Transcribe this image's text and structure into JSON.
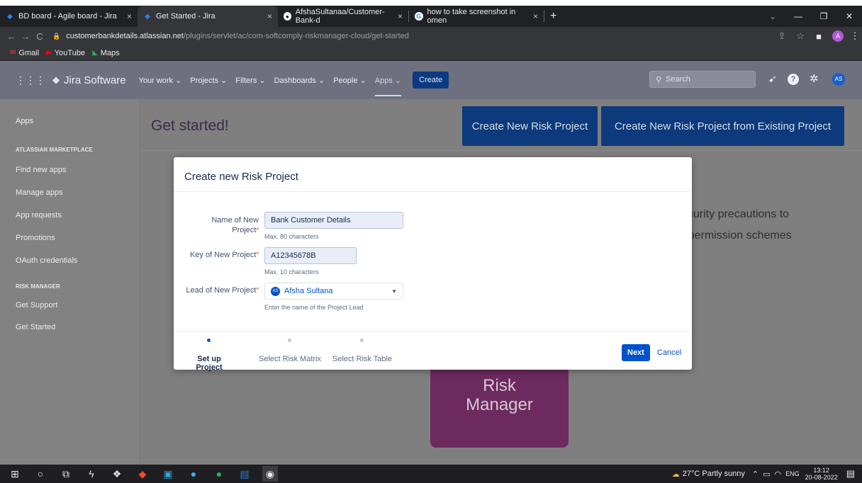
{
  "browser": {
    "tabs": [
      {
        "title": "BD board - Agile board - Jira"
      },
      {
        "title": "Get Started - Jira"
      },
      {
        "title": "AfshaSultanaa/Customer-Bank-d"
      },
      {
        "title": "how to take screenshot in omen"
      }
    ],
    "new_tab": "+",
    "url_domain": "customerbankdetails.atlassian.net",
    "url_path": "/plugins/servlet/ac/com-softcomply-riskmanager-cloud/get-started",
    "profile_initial": "A",
    "bookmarks": [
      {
        "label": "Gmail",
        "icon": "gmail-icon"
      },
      {
        "label": "YouTube",
        "icon": "youtube-icon"
      },
      {
        "label": "Maps",
        "icon": "maps-icon"
      }
    ]
  },
  "jira": {
    "product": "Jira Software",
    "nav": [
      "Your work",
      "Projects",
      "Filters",
      "Dashboards",
      "People",
      "Apps"
    ],
    "create_label": "Create",
    "search_placeholder": "Search",
    "avatar_initials": "AS"
  },
  "sidebar": {
    "apps_label": "Apps",
    "marketplace_heading": "ATLASSIAN MARKETPLACE",
    "marketplace_items": [
      "Find new apps",
      "Manage apps",
      "App requests",
      "Promotions",
      "OAuth credentials"
    ],
    "risk_heading": "RISK MANAGER",
    "risk_items": [
      "Get Support",
      "Get Started"
    ]
  },
  "content": {
    "title": "Get started!",
    "create_new_btn": "Create New Risk Project",
    "create_from_existing_btn": "Create New Risk Project from Existing Project",
    "bg_text_right_1": "ecurity precautions to",
    "bg_text_right_2": "r permission schemes",
    "risk_logo_line1": "Risk",
    "risk_logo_line2": "Manager"
  },
  "modal": {
    "title": "Create new Risk Project",
    "name_label": "Name of New Project",
    "name_value": "Bank Customer Details",
    "name_hint": "Max. 80 characters",
    "key_label": "Key of New Project",
    "key_value": "A12345678B",
    "key_hint": "Max. 10 characters",
    "lead_label": "Lead of New Project",
    "lead_value": "Afsha Sultana",
    "lead_avatar": "AS",
    "lead_hint": "Enter the name of the Project Lead",
    "steps": [
      "Set up Project",
      "Select Risk Matrix",
      "Select Risk Table"
    ],
    "next_label": "Next",
    "cancel_label": "Cancel"
  },
  "taskbar": {
    "weather": "27°C  Partly sunny",
    "lang": "ENG",
    "time": "13:12",
    "date": "20-08-2022"
  },
  "colors": {
    "jira_blue": "#0052cc",
    "modal_bg": "#ffffff",
    "overlay": "#7f7f7f"
  }
}
